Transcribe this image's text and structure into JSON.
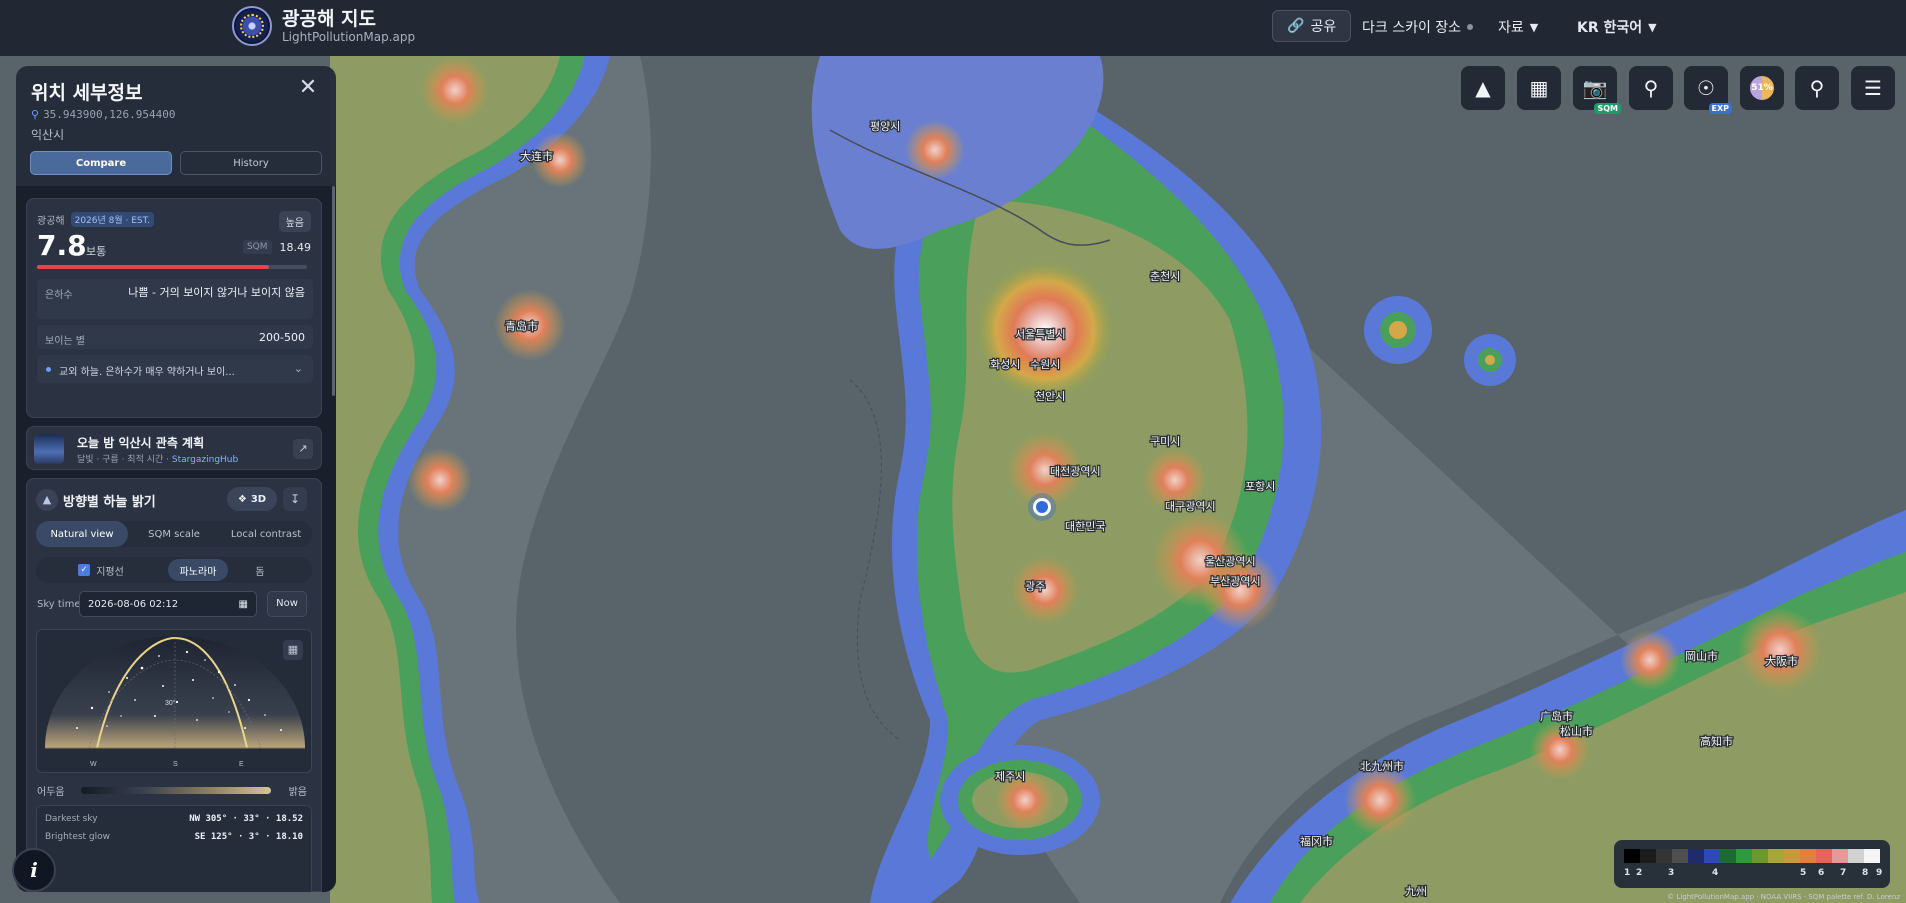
{
  "brand": {
    "title": "광공해 지도",
    "subtitle": "LightPollutionMap.app"
  },
  "topnav": {
    "share": "공유",
    "dark_places": "다크 스카이 장소",
    "resources": "자료",
    "language": "KR 한국어"
  },
  "toolbar": {
    "sqm_badge": "SQM",
    "exp_badge": "EXP",
    "moon_percent": "51%",
    "icons": [
      "horizon-icon",
      "grid-icon",
      "camera-icon",
      "pin-icon",
      "globe-icon",
      "moon-icon",
      "search-icon",
      "layers-icon"
    ]
  },
  "panel": {
    "title": "위치 세부정보",
    "coords": "35.943900,126.954400",
    "city": "익산시",
    "tabs": {
      "compare": "Compare",
      "history": "History"
    }
  },
  "lp_card": {
    "label": "광공해",
    "date_chip": "2026년 8월 · EST.",
    "level": "높음",
    "value": "7.8",
    "value_word": "보통",
    "sqm_label": "SQM",
    "sqm_value": "18.49",
    "bar_fraction": 0.86,
    "milky_way_label": "은하수",
    "milky_way_value": "나쁨 - 거의 보이지 않거나 보이지 않음",
    "stars_label": "보이는 별",
    "stars_value": "200-500",
    "note": "교외 하늘. 은하수가 매우 약하거나 보이..."
  },
  "plan_card": {
    "title": "오늘 밤 익산시 관측 계획",
    "sub": "달빛 · 구름 · 최적 시간 · ",
    "hub": "StargazingHub"
  },
  "dir_card": {
    "title": "방향별 하늘 밝기",
    "btn_3d": "3D",
    "tabs": {
      "natural": "Natural view",
      "sqm": "SQM scale",
      "local": "Local contrast"
    },
    "horizon": "지평선",
    "panorama": "파노라마",
    "dome": "돔",
    "skytime_label": "Sky time",
    "skytime_value": "2026-08-06 02:12",
    "now": "Now",
    "compass": {
      "w": "W",
      "s": "S",
      "e": "E",
      "alt": "30°"
    },
    "scale_dark": "어두움",
    "scale_bright": "밝음",
    "darkest_label": "Darkest sky",
    "darkest_value": "NW 305° · 33° · 18.52",
    "brightest_label": "Brightest glow",
    "brightest_value": "SE 125° · 3° · 18.10"
  },
  "legend": {
    "colors": [
      "#000000",
      "#1c1c1c",
      "#353535",
      "#505050",
      "#1f2b6b",
      "#3049b8",
      "#1d6b32",
      "#2e9a3e",
      "#6c9a2e",
      "#a7a63b",
      "#c99a3b",
      "#e0823e",
      "#e8645a",
      "#e89a9a",
      "#d2d2d2",
      "#f5f5f5"
    ],
    "labels": [
      "1",
      "2",
      "3",
      "4",
      "5",
      "6",
      "7",
      "8",
      "9"
    ]
  },
  "map_labels": {
    "seoul": "서울특별시",
    "chuncheon": "춘천시",
    "daejeon": "대전광역시",
    "daegu": "대구광역시",
    "gwangju": "광주",
    "ulsan": "울산광역시",
    "busan": "부산광역시",
    "jeju": "제주시",
    "pyongyang": "평양시",
    "dalian": "大连市",
    "qingdao": "青岛市",
    "fukuoka": "福冈市",
    "kitakyushu": "北九州市",
    "hiroshima": "广岛市",
    "okayama": "岡山市",
    "osaka": "大阪市",
    "kochi": "高知市",
    "matsuyama": "松山市",
    "kyushu": "九州",
    "daejeon2": "대한민국",
    "hwaseong": "화성시",
    "suwon": "수원시",
    "cheonan": "천안시",
    "gumi": "구미시",
    "pohang": "포항시"
  },
  "attribution": "© LightPollutionMap.app · NOAA VIIRS · SQM palette ref. D. Lorenz"
}
